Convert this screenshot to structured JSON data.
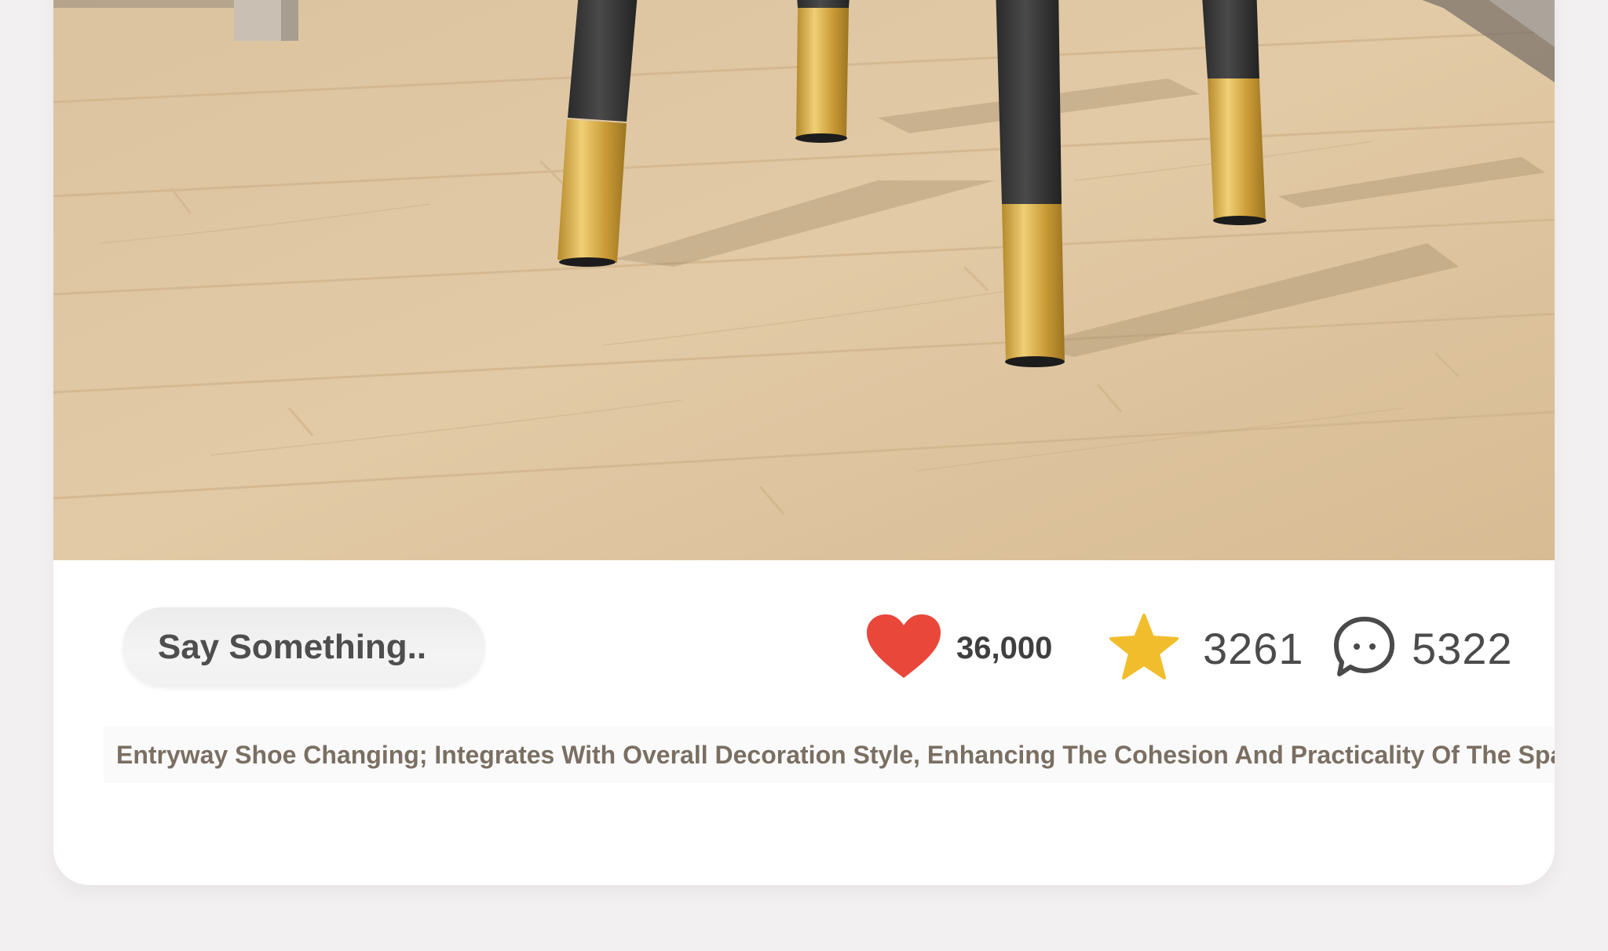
{
  "post": {
    "comment_placeholder": "Say Something..",
    "likes": "36,000",
    "favorites": "3261",
    "comments": "5322",
    "description": "Entryway Shoe Changing; Integrates With Overall Decoration Style, Enhancing The Cohesion And Practicality Of The Space."
  },
  "icons": {
    "like": "heart-icon",
    "favorite": "star-icon",
    "comment": "comment-bubble-icon"
  },
  "colors": {
    "heart": "#e8473a",
    "star": "#f2bd2d",
    "description_text": "#7a6f62",
    "background": "#f3f0f1"
  }
}
